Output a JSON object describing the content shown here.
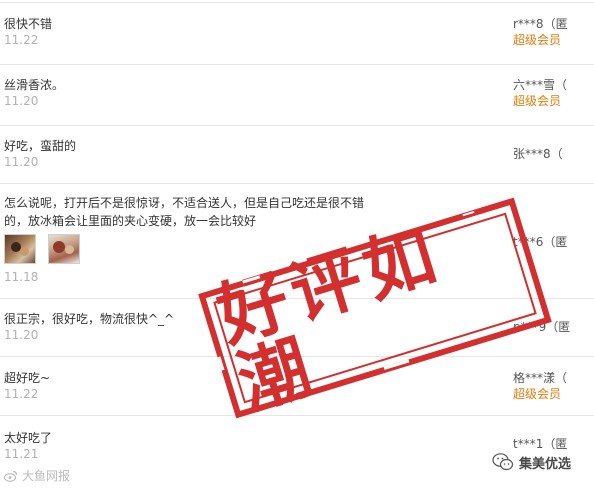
{
  "reviews": [
    {
      "text": "很快不错",
      "date": "11.22",
      "user": "r***8（匿",
      "level": "超级会员"
    },
    {
      "text": "丝滑香浓。",
      "date": "11.20",
      "user": "六***雪（",
      "level": "超级会员"
    },
    {
      "text": "好吃，蛮甜的",
      "date": "11.20",
      "user": "张***8（",
      "level": ""
    },
    {
      "text": "怎么说呢，打开后不是很惊讶，不适合送人，但是自己吃还是很不错的，放冰箱会让里面的夹心变硬，放一会比较好",
      "date": "11.18",
      "user": "t***6（匿",
      "level": ""
    },
    {
      "text": "很正宗，很好吃，物流很快^_^",
      "date": "11.20",
      "user": "p***9（匿",
      "level": ""
    },
    {
      "text": "超好吃~",
      "date": "11.22",
      "user": "格***漾（",
      "level": "超级会员"
    },
    {
      "text": "太好吃了",
      "date": "11.21",
      "user": "t***1（匿",
      "level": ""
    }
  ],
  "stamp": {
    "text": "好评如潮",
    "color": "#d42f2f"
  },
  "watermarks": {
    "left": "大鱼网报",
    "right": "集美优选"
  },
  "colors": {
    "vip": "#e57d0e",
    "date": "#b3b3b3",
    "divider": "#e6e6e6"
  }
}
